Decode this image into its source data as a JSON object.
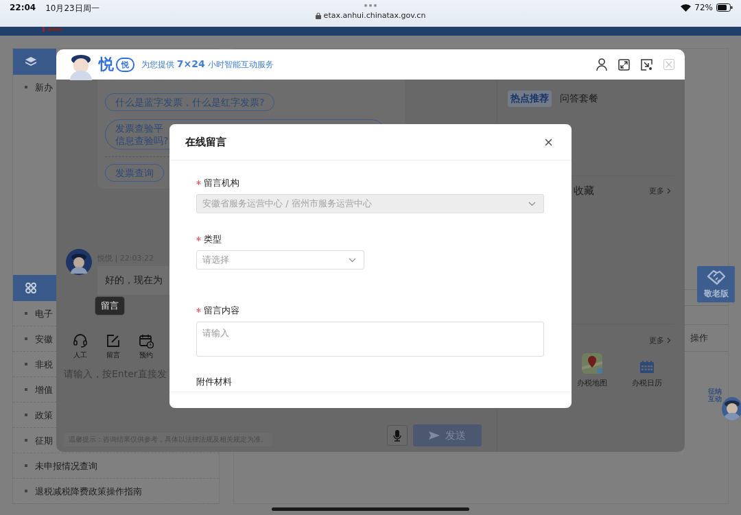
{
  "status_bar": {
    "time": "22:04",
    "date": "10月23日周一",
    "url": "etax.anhui.chinatax.gov.cn",
    "battery": "72%"
  },
  "page": {
    "sections": [
      {
        "kind": "layers",
        "items": [
          "新办"
        ]
      },
      {
        "kind": "grid",
        "items": [
          "电子",
          "安徽",
          "非税",
          "增值",
          "政策",
          "征期",
          "未申报情况查询",
          "退税减税降费政策操作指南"
        ]
      }
    ],
    "column_label": "操作",
    "elder_button": "敬老版",
    "assistant_badge": "征纳互动"
  },
  "chat": {
    "brand": "悦",
    "brand_badge": "悦",
    "tagline": "为您提供 **7×24** 小时智能互动服务",
    "suggestions": [
      {
        "lines": [
          "什么是蓝字发票，什么是红字发票?"
        ]
      },
      {
        "lines": [
          "发票查验平",
          "信息查验吗?"
        ]
      }
    ],
    "quick_chip": "发票查询",
    "message": {
      "meta": "悦悦 | 22:03:22",
      "text": "好的，现在为"
    },
    "tooltip": "留言",
    "tools": [
      {
        "kind": "headset",
        "label": "人工"
      },
      {
        "kind": "edit",
        "label": "留言"
      },
      {
        "kind": "calendar",
        "label": "预约"
      }
    ],
    "input_placeholder": "请输入，按Enter直接发",
    "tip": "温馨提示：咨询结果仅供参考，具体以法律法规及相关规定为准。",
    "send": "发送",
    "side": {
      "tabs": [
        {
          "label": "热点推荐",
          "selected": true
        },
        {
          "label": "问答套餐",
          "selected": false
        }
      ],
      "favorites_title": "收藏",
      "more": [
        "更多",
        "更多"
      ],
      "apps": [
        {
          "kind": "map",
          "label": "办税地图"
        },
        {
          "kind": "calendar",
          "label": "办税日历"
        }
      ]
    }
  },
  "modal": {
    "title": "在线留言",
    "fields": [
      {
        "label": "留言机构",
        "required": true,
        "kind": "select",
        "value": "安徽省服务运营中心 / 宿州市服务运营中心",
        "disabled": true,
        "wide": true
      },
      {
        "label": "类型",
        "required": true,
        "kind": "select",
        "placeholder": "请选择",
        "disabled": false,
        "wide": false
      },
      {
        "label": "留言内容",
        "required": true,
        "kind": "textarea",
        "placeholder": "请输入"
      }
    ],
    "attachment_label": "附件材料"
  }
}
